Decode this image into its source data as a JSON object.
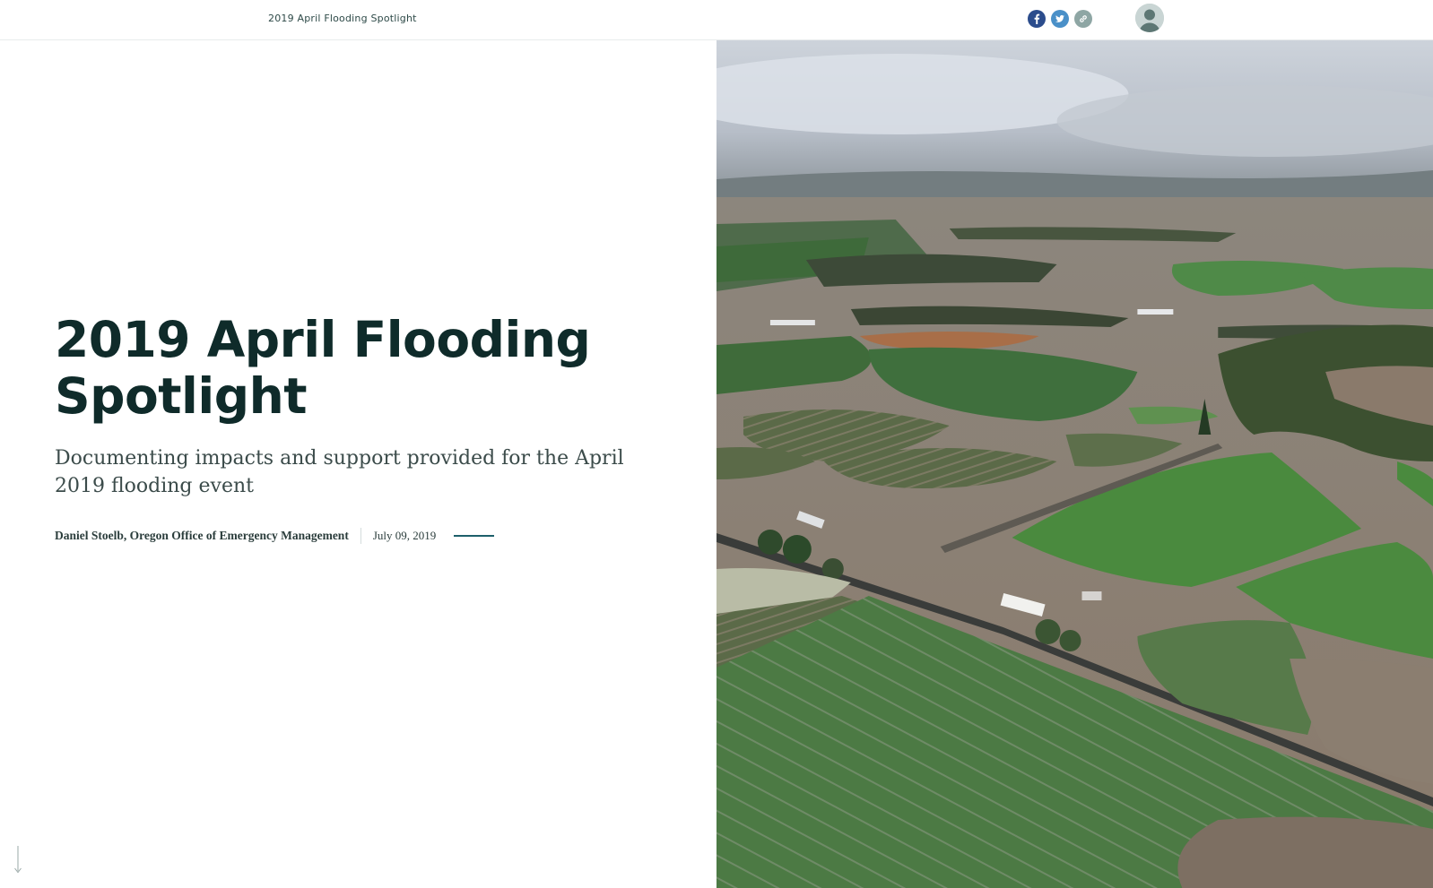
{
  "header": {
    "story_title": "2019 April Flooding Spotlight",
    "share_icons": [
      "facebook-icon",
      "twitter-icon",
      "link-icon"
    ],
    "avatar_icon": "user-avatar-icon"
  },
  "cover": {
    "title": "2019 April Flooding Spotlight",
    "subtitle": "Documenting impacts and support provided for the April 2019 flooding event",
    "author": "Daniel Stoelb, Oregon Office of Emergency Management",
    "date": "July 09, 2019",
    "scroll_icon": "arrow-down-icon"
  },
  "media": {
    "kind": "aerial photo of flooded farmland"
  },
  "colors": {
    "title": "#0f2b2a",
    "accent": "#1d5f6a",
    "facebook": "#2b4c8c",
    "twitter": "#4a90c8",
    "link": "#8ea6a4"
  }
}
